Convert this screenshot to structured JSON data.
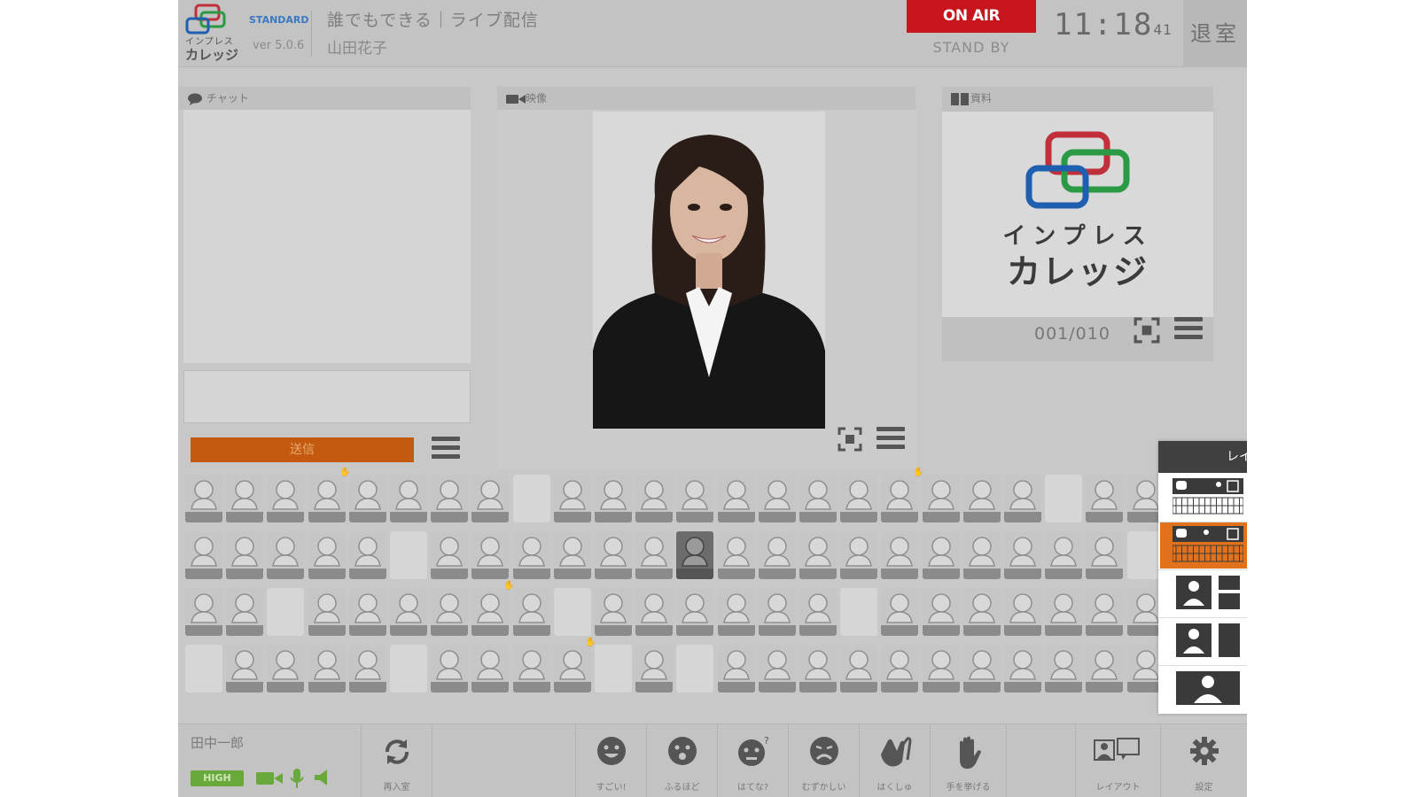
{
  "header": {
    "logo_line1": "インプレス",
    "logo_line2": "カレッジ",
    "edition": "STANDARD",
    "version": "ver 5.0.6",
    "lecture_title": "誰でもできる｜ライブ配信",
    "teacher": "山田花子",
    "on_air": "ON AIR",
    "stand_by": "STAND BY",
    "clock_hm": "11:18",
    "clock_s": "41",
    "exit_label": "退室"
  },
  "chat": {
    "header": "チャット",
    "send_label": "送信"
  },
  "video": {
    "header": "映像"
  },
  "material": {
    "header": "資料",
    "logo_line1": "インプレス",
    "logo_line2": "カレッジ",
    "page_counter": "001/010"
  },
  "footer": {
    "user_name": "田中一郎",
    "quality": "HIGH",
    "buttons": {
      "rejoin": "再入室",
      "great": "すごい!",
      "so_so": "ふるほど",
      "question": "はてな?",
      "difficult": "むずかしい",
      "clap": "はくしゅ",
      "raise_hand": "手を挙げる",
      "layout": "レイアウト",
      "settings": "設定"
    }
  },
  "layout_popup": {
    "title": "レイアウト",
    "close": "×",
    "selected_option": 3
  },
  "colors": {
    "on_air": "#c8141c",
    "send_button": "#c35a0f",
    "high_badge": "#69a83a",
    "popup_close": "#e03a14",
    "popup_selected": "#e2711c"
  },
  "icons": [
    "chat-bubble-icon",
    "video-camera-icon",
    "document-icon",
    "fullscreen-icon",
    "menu-icon",
    "refresh-icon",
    "smile-icon",
    "surprised-icon",
    "question-face-icon",
    "sad-face-icon",
    "clap-icon",
    "hand-icon",
    "layout-icon",
    "gear-icon",
    "camera-icon",
    "mic-icon",
    "speaker-icon"
  ]
}
